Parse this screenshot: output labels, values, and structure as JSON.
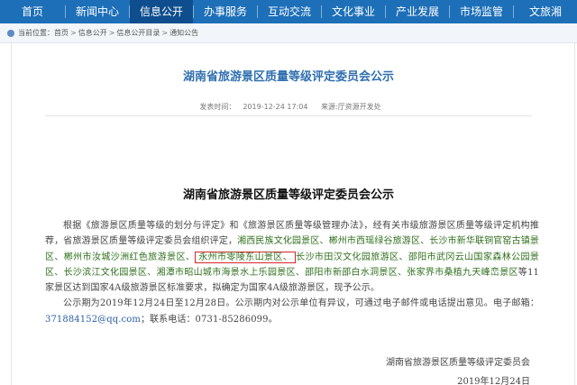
{
  "nav": {
    "items": [
      {
        "label": "首页"
      },
      {
        "label": "新闻中心"
      },
      {
        "label": "信息公开",
        "active": true
      },
      {
        "label": "办事服务"
      },
      {
        "label": "互动交流"
      },
      {
        "label": "文化事业"
      },
      {
        "label": "产业发展"
      },
      {
        "label": "市场监管"
      },
      {
        "label": "文旅湘"
      }
    ],
    "color": "#1d6fb8",
    "active_color": "#0f4e8e"
  },
  "breadcrumb": {
    "prefix": "当前位置：",
    "items": [
      "首页",
      "信息公开",
      "信息公开目录",
      "通知公告"
    ],
    "separator": ">"
  },
  "article": {
    "title": "湖南省旅游景区质量等级评定委员会公示",
    "date": "2019-12-24 17:04",
    "source_label": "发表时间：",
    "origin": "来源:厅资源开发处",
    "doc_title": "湖南省旅游景区质量等级评定委员会公示",
    "para1": {
      "a": "根据《旅游景区质量等级的划分与评定》和《旅游景区质量等级管理办法》，经有关市级旅游景区质量等级评定机构推荐，省旅游景区质量等级评定委员会组织评定，",
      "hl1": "湘西民族文化园景区、郴州市西瑶绿谷旅游区、长沙市新华联铜官窑古镇景区、郴州市汝城沙洲红色旅游景区、",
      "boxed": "永州市零陵东山景区、",
      "hl2": "长沙市田汉文化园旅游区、邵阳市武冈云山国家森林公园景区、长沙滨江文化园景区、湘潭市昭山城市海景水上乐园景区、邵阳市新邵白水洞景区、张家界市桑植九天峰峦景区",
      "b": "等11家景区达到国家4A级旅游景区标准要求，拟确定为国家4A级旅游景区，现予公示。"
    },
    "para2": {
      "a": "公示期为2019年12月24日至12月28日。公示期内对公示单位有异议，可通过电子邮件或电话提出意见。电子邮箱：",
      "email": "371884152@qq.com",
      "b": "；联系电话：0731-85286099。"
    },
    "signature": {
      "org": "湖南省旅游景区质量等级评定委员会",
      "date": "2019年12月24日"
    }
  }
}
